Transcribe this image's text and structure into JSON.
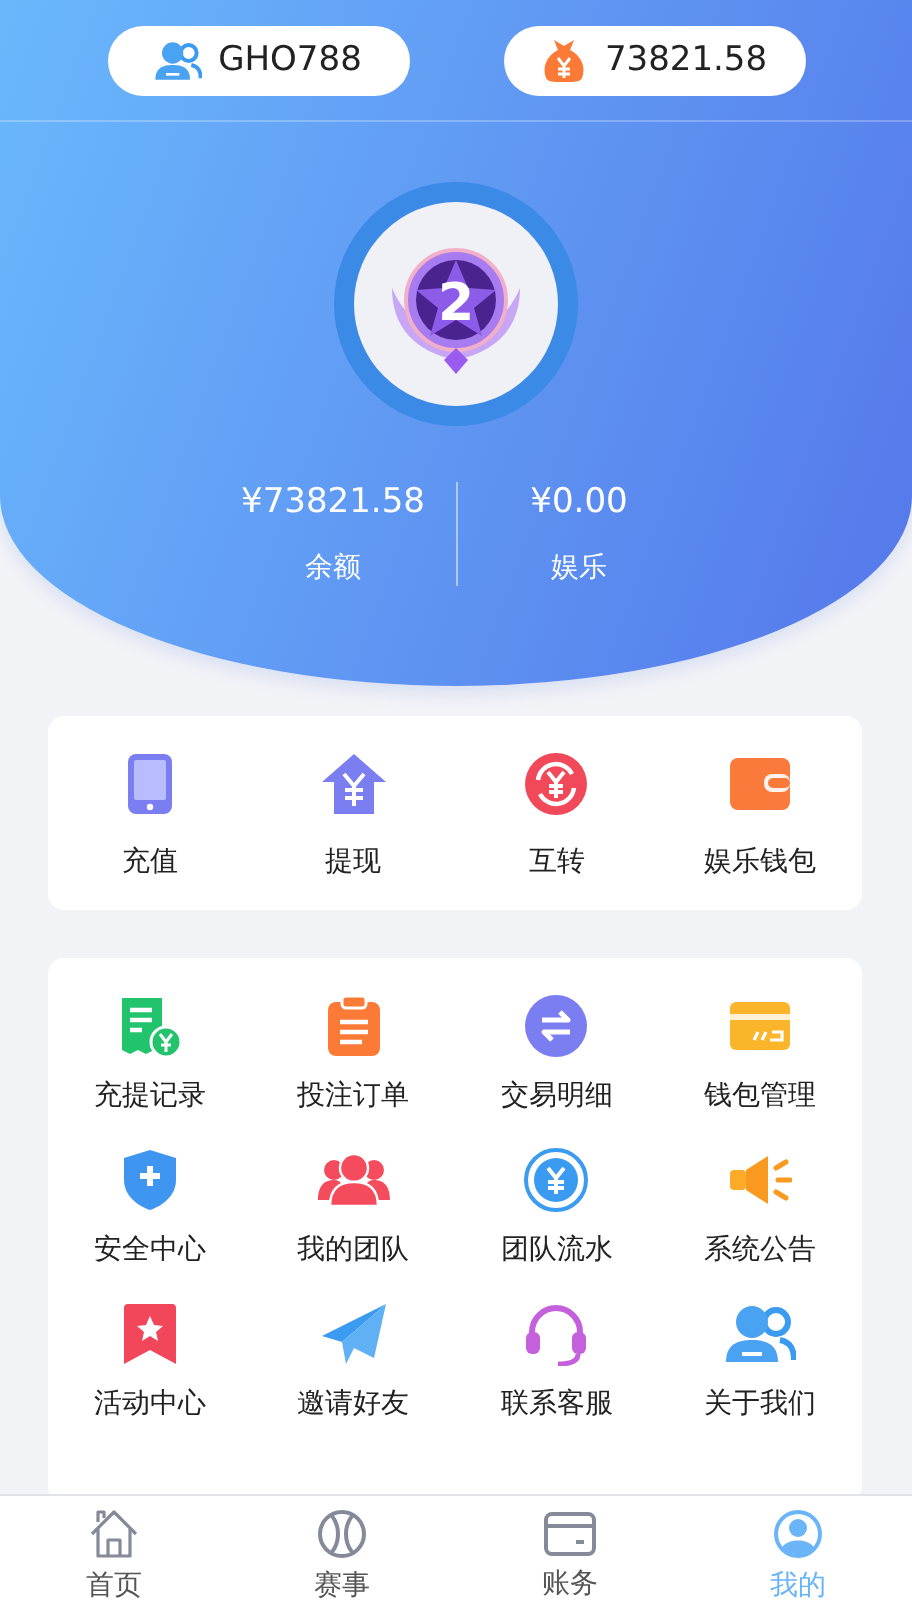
{
  "top_bar": {
    "username": "GHO788",
    "balance": "73821.58"
  },
  "vip": {
    "level_badge": "2"
  },
  "wallets": [
    {
      "amount": "¥73821.58",
      "label": "余额"
    },
    {
      "amount": "¥0.00",
      "label": "娱乐"
    }
  ],
  "quick_actions": [
    {
      "label": "充值"
    },
    {
      "label": "提现"
    },
    {
      "label": "互转"
    },
    {
      "label": "娱乐钱包"
    }
  ],
  "services": [
    {
      "label": "充提记录"
    },
    {
      "label": "投注订单"
    },
    {
      "label": "交易明细"
    },
    {
      "label": "钱包管理"
    },
    {
      "label": "安全中心"
    },
    {
      "label": "我的团队"
    },
    {
      "label": "团队流水"
    },
    {
      "label": "系统公告"
    },
    {
      "label": "活动中心"
    },
    {
      "label": "邀请好友"
    },
    {
      "label": "联系客服"
    },
    {
      "label": "关于我们"
    }
  ],
  "tab_bar": [
    {
      "label": "首页",
      "selected": false
    },
    {
      "label": "赛事",
      "selected": false
    },
    {
      "label": "账务",
      "selected": false
    },
    {
      "label": "我的",
      "selected": true
    }
  ]
}
